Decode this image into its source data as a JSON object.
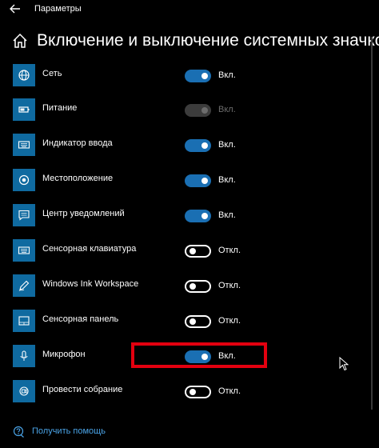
{
  "window": {
    "title": "Параметры"
  },
  "page": {
    "title": "Включение и выключение системных значков"
  },
  "rows": [
    {
      "label": "Сеть",
      "icon": "globe-icon",
      "state": "on",
      "state_label": "Вкл."
    },
    {
      "label": "Питание",
      "icon": "battery-icon",
      "state": "disabled",
      "state_label": "Вкл."
    },
    {
      "label": "Индикатор ввода",
      "icon": "keyboard-icon",
      "state": "on",
      "state_label": "Вкл."
    },
    {
      "label": "Местоположение",
      "icon": "location-icon",
      "state": "on",
      "state_label": "Вкл."
    },
    {
      "label": "Центр уведомлений",
      "icon": "message-icon",
      "state": "on",
      "state_label": "Вкл."
    },
    {
      "label": "Сенсорная клавиатура",
      "icon": "keyboard-icon",
      "state": "off",
      "state_label": "Откл."
    },
    {
      "label": "Windows Ink Workspace",
      "icon": "pen-icon",
      "state": "off",
      "state_label": "Откл."
    },
    {
      "label": "Сенсорная панель",
      "icon": "touchpad-icon",
      "state": "off",
      "state_label": "Откл."
    },
    {
      "label": "Микрофон",
      "icon": "microphone-icon",
      "state": "on",
      "state_label": "Вкл."
    },
    {
      "label": "Провести собрание",
      "icon": "meet-now-icon",
      "state": "off",
      "state_label": "Откл."
    }
  ],
  "help": {
    "label": "Получить помощь"
  },
  "colors": {
    "accent": "#1a6fb3",
    "tile": "#0f6aa0",
    "highlight": "#e3000f",
    "link": "#4aa3e6"
  }
}
